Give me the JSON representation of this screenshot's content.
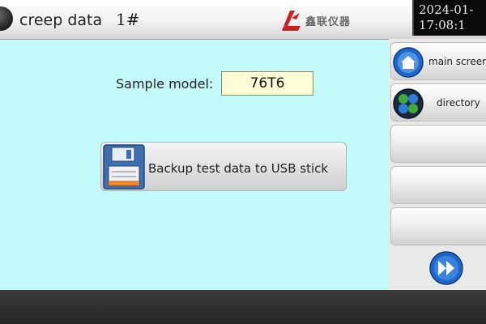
{
  "header": {
    "title": "creep data",
    "machine_no": "1#",
    "logo_text": "鑫联仪器",
    "clock": {
      "date": "2024-01-",
      "time": "17:08:1"
    }
  },
  "main": {
    "sample_model_label": "Sample model:",
    "sample_model_value": "76T6",
    "backup_button_label": "Backup test data to USB stick"
  },
  "side_panel": {
    "buttons": [
      {
        "label": "main screen",
        "icon": "home-icon"
      },
      {
        "label": "directory",
        "icon": "directory-icon"
      },
      {
        "label": ""
      },
      {
        "label": ""
      },
      {
        "label": ""
      }
    ],
    "next_icon": "fast-forward-icon"
  },
  "colors": {
    "background": "#c3fbfb",
    "input_bg": "#fefdd6",
    "logo_red": "#cc1f1f",
    "accent_blue": "#1e66c7"
  }
}
